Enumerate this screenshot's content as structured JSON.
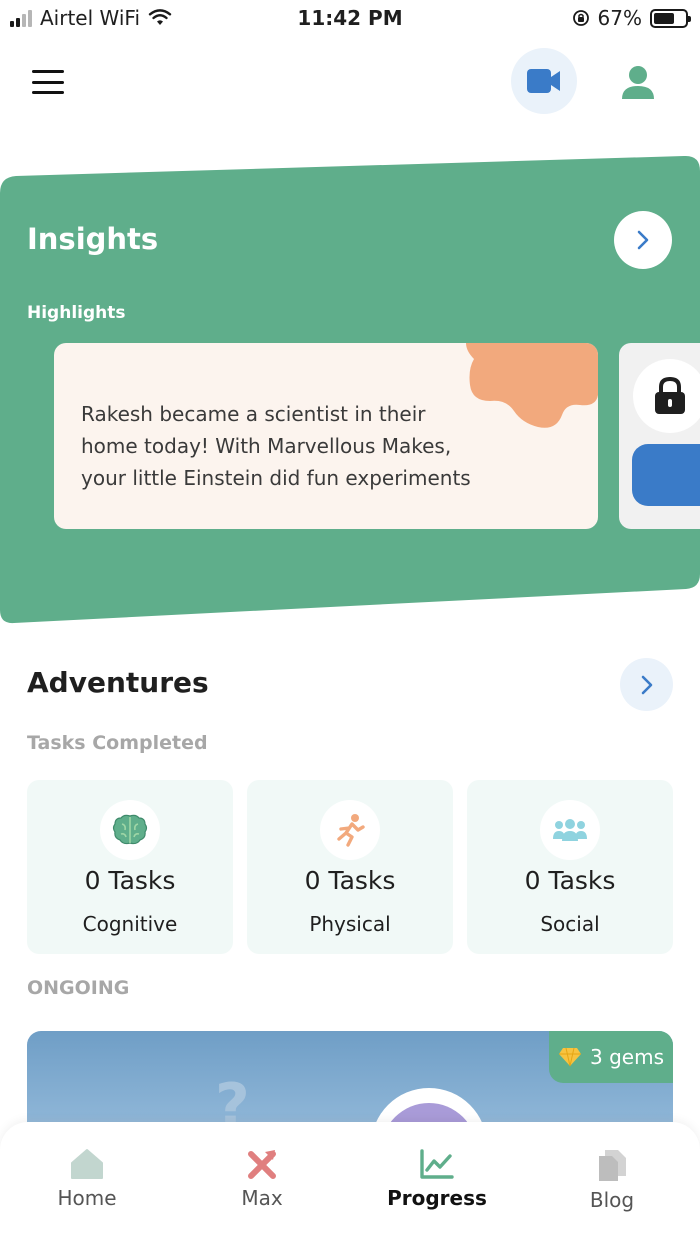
{
  "status_bar": {
    "carrier": "Airtel WiFi",
    "time": "11:42 PM",
    "battery": "67%",
    "battery_level": 0.67
  },
  "insights": {
    "title": "Insights",
    "highlights_label": "Highlights",
    "highlight_text": "Rakesh became a scientist in their home today! With Marvellous Makes, your little Einstein did fun experiments",
    "colors": {
      "panel": "#5fae8b",
      "card": "#fcf4ee",
      "blob": "#f2a97d",
      "locked_bar": "#3a7bc8"
    }
  },
  "adventures": {
    "title": "Adventures",
    "tasks_completed_label": "Tasks Completed",
    "tasks": [
      {
        "count": "0 Tasks",
        "category": "Cognitive",
        "icon": "brain-icon",
        "color": "#5fae8b"
      },
      {
        "count": "0 Tasks",
        "category": "Physical",
        "icon": "running-person-icon",
        "color": "#f2a97d"
      },
      {
        "count": "0 Tasks",
        "category": "Social",
        "icon": "group-icon",
        "color": "#8fd3df"
      }
    ],
    "ongoing_label": "ONGOING",
    "ongoing_gems": "3 gems"
  },
  "nav": {
    "items": [
      {
        "label": "Home",
        "icon": "home-icon",
        "active": false
      },
      {
        "label": "Max",
        "icon": "max-icon",
        "active": false
      },
      {
        "label": "Progress",
        "icon": "chart-icon",
        "active": true
      },
      {
        "label": "Blog",
        "icon": "document-icon",
        "active": false
      }
    ]
  }
}
